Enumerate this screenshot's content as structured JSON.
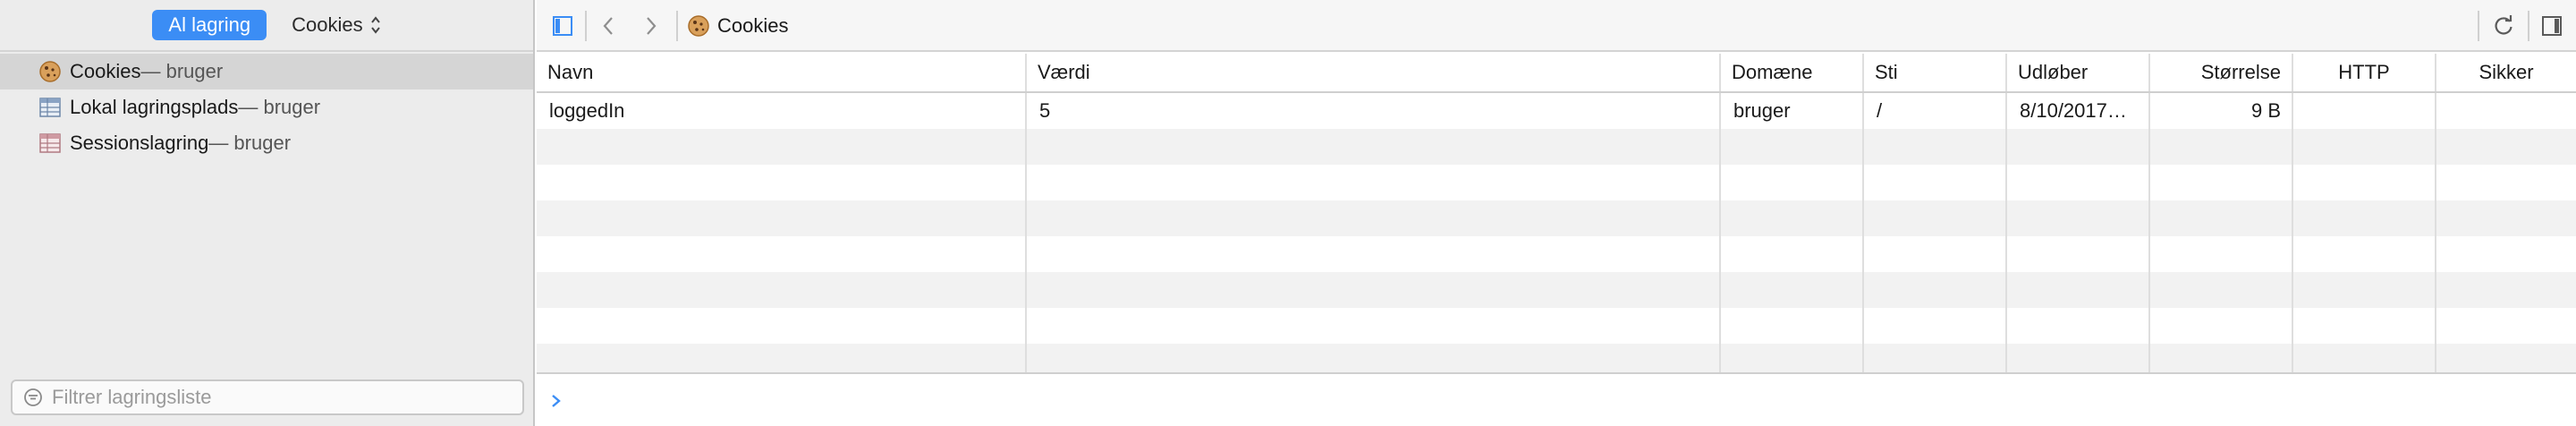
{
  "sidebar": {
    "scope_active": "Al lagring",
    "scope_select": "Cookies",
    "items": [
      {
        "label": "Cookies",
        "sub": " — bruger",
        "icon": "cookie-icon"
      },
      {
        "label": "Lokal lagringsplads",
        "sub": " — bruger",
        "icon": "storage-table-icon"
      },
      {
        "label": "Sessionslagring",
        "sub": " — bruger",
        "icon": "storage-table-icon"
      }
    ],
    "filter_placeholder": "Filtrer lagringsliste"
  },
  "toolbar": {
    "breadcrumb": "Cookies",
    "icons": [
      "sidebar-toggle-icon",
      "back-icon",
      "forward-icon",
      "refresh-icon",
      "details-toggle-icon"
    ]
  },
  "table": {
    "columns": [
      "Navn",
      "Værdi",
      "Domæne",
      "Sti",
      "Udløber",
      "Størrelse",
      "HTTP",
      "Sikker"
    ],
    "rows": [
      [
        "loggedIn",
        "5",
        "bruger",
        "/",
        "8/10/2017…",
        "9 B",
        "",
        ""
      ]
    ]
  },
  "colors": {
    "accent": "#3b8df5",
    "sidebar_bg": "#ececec",
    "row_alt": "#f2f2f2"
  }
}
